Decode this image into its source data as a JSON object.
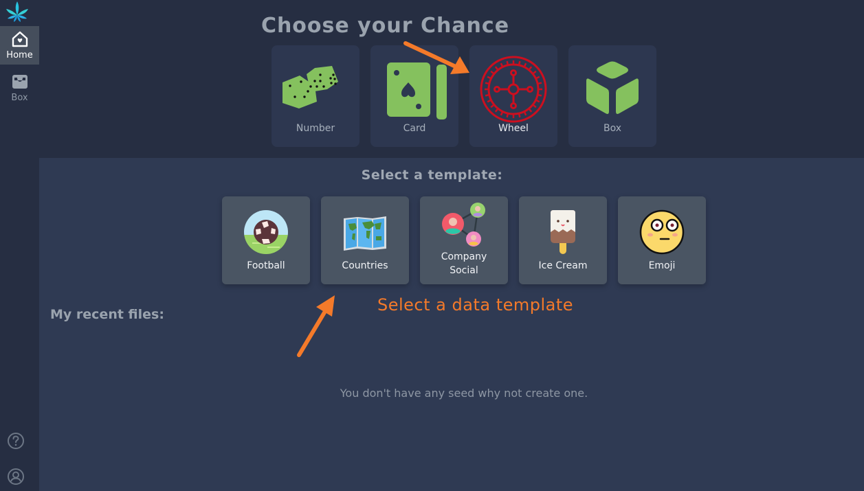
{
  "sidebar": {
    "logo_icon": "leaf-logo-icon",
    "items": [
      {
        "label": "Home",
        "icon": "home-heart-icon",
        "active": true
      },
      {
        "label": "Box",
        "icon": "inbox-tray-icon",
        "active": false
      }
    ],
    "bottom": [
      {
        "icon": "help-circle-icon"
      },
      {
        "icon": "user-circle-icon"
      }
    ]
  },
  "header": {
    "title": "Choose your Chance",
    "chances": [
      {
        "label": "Number",
        "icon": "dice-icon"
      },
      {
        "label": "Card",
        "icon": "playing-card-icon"
      },
      {
        "label": "Wheel",
        "icon": "roulette-wheel-icon",
        "selected": true
      },
      {
        "label": "Box",
        "icon": "cube-icon"
      }
    ]
  },
  "templates": {
    "title": "Select a template:",
    "items": [
      {
        "label": "Football",
        "icon": "football-icon"
      },
      {
        "label": "Countries",
        "icon": "world-map-icon"
      },
      {
        "label_line1": "Company",
        "label_line2": "Social",
        "icon": "social-network-icon"
      },
      {
        "label": "Ice Cream",
        "icon": "ice-cream-icon"
      },
      {
        "label": "Emoji",
        "icon": "emoji-face-icon"
      }
    ]
  },
  "recent": {
    "title": "My recent files:",
    "empty_message": "You don't have any seed why not create one."
  },
  "annotation": {
    "text": "Select a data template",
    "color": "#f47a2a"
  },
  "colors": {
    "green": "#85c15e",
    "wheel_red": "#cc0f1f",
    "accent_orange": "#f47a2a"
  }
}
